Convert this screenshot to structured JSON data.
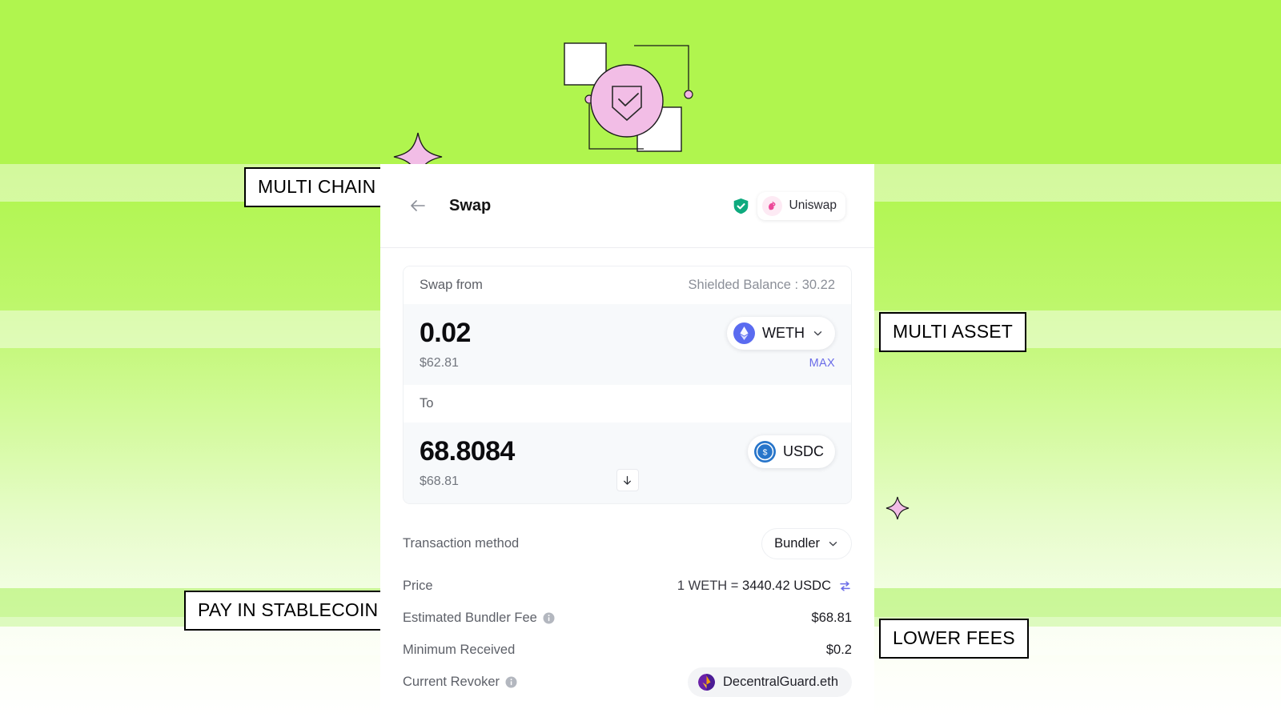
{
  "background": {
    "accent_green": "#b0f54e",
    "sparkle_pink": "#f4c2e8"
  },
  "callouts": [
    {
      "id": "multi-chain",
      "label": "MULTI CHAIN"
    },
    {
      "id": "multi-asset",
      "label": "MULTI ASSET"
    },
    {
      "id": "pay-stablecoin",
      "label": "PAY IN STABLECOIN"
    },
    {
      "id": "lower-fees",
      "label": "LOWER FEES"
    }
  ],
  "card": {
    "header": {
      "back_icon": "arrow-left-icon",
      "title": "Swap",
      "verified_icon": "shield-check-icon",
      "dex": {
        "name": "Uniswap",
        "icon": "unicorn-icon"
      }
    },
    "swap_panel": {
      "from": {
        "label": "Swap from",
        "balance_label": "Shielded Balance : 30.22",
        "amount": "0.02",
        "fiat": "$62.81",
        "max_label": "MAX",
        "token": {
          "symbol": "WETH",
          "icon": "ethereum-icon",
          "color": "#5a6bf0"
        },
        "chevron": "chevron-down-icon"
      },
      "direction_icon": "arrow-down-icon",
      "to": {
        "label": "To",
        "amount": "68.8084",
        "fiat": "$68.81",
        "token": {
          "symbol": "USDC",
          "icon": "usdc-icon",
          "color": "#2775ca"
        }
      }
    },
    "details": {
      "method": {
        "label": "Transaction method",
        "value": "Bundler",
        "chevron": "chevron-down-icon"
      },
      "price": {
        "label": "Price",
        "left": "1 WETH = ",
        "right": "3440.42 USDC",
        "swap_icon": "swap-arrows-icon"
      },
      "bundler_fee": {
        "label": "Estimated Bundler Fee",
        "info_icon": "info-icon",
        "value": "$68.81"
      },
      "minimum_received": {
        "label": "Minimum Received",
        "value": "$0.2"
      },
      "revoker": {
        "label": "Current Revoker",
        "info_icon": "info-icon",
        "value": "DecentralGuard.eth",
        "avatar_icon": "ens-avatar-icon"
      }
    }
  }
}
